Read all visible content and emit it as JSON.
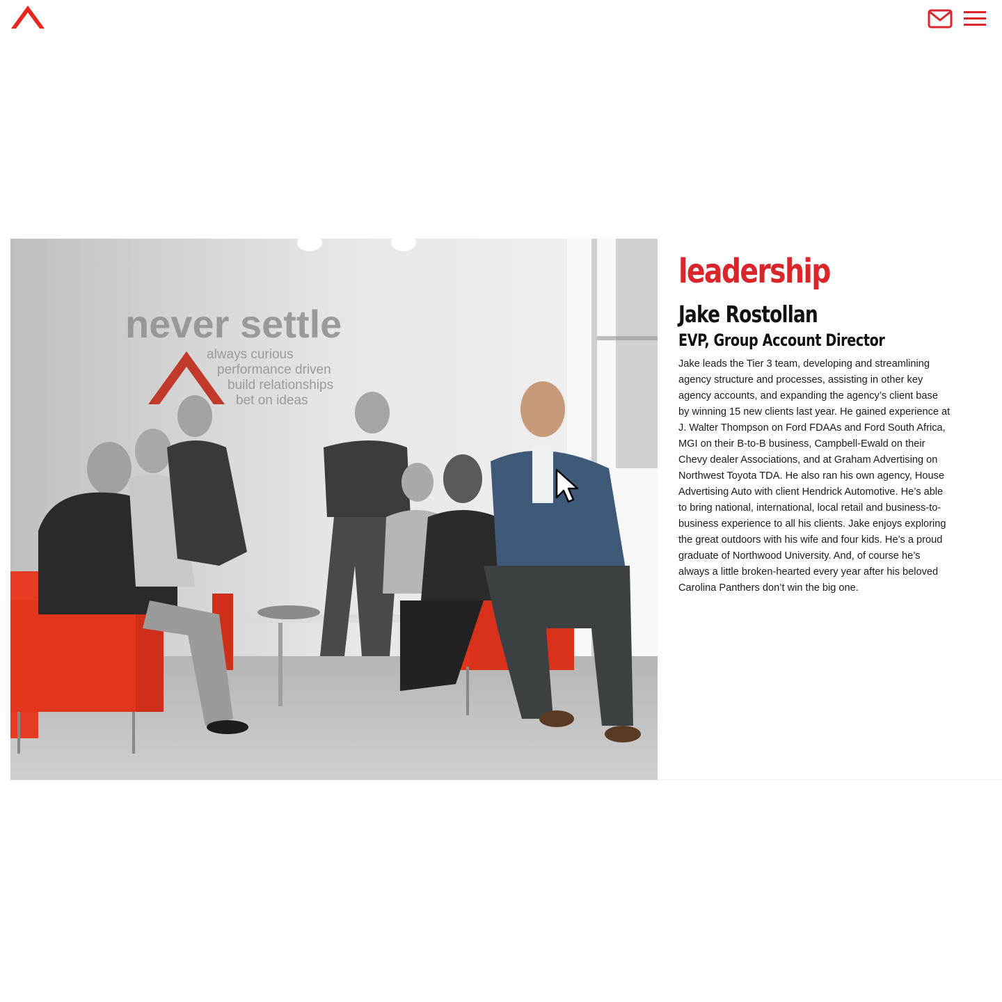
{
  "header": {
    "logo_alt": "agency logo",
    "contact_icon": "mail-icon",
    "menu_icon": "hamburger-menu-icon"
  },
  "photo": {
    "wall_headline": "never settle",
    "wall_values": [
      "always curious",
      "performance driven",
      "build relationships",
      "bet on ideas"
    ]
  },
  "leadership": {
    "section_title": "leadership",
    "name": "Jake Rostollan",
    "role": "EVP, Group Account Director",
    "bio": "Jake leads the Tier 3 team, developing and streamlining agency structure and processes, assisting in other key agency accounts, and expanding the agency’s client base by winning 15 new clients last year. He gained experience at J. Walter Thompson on Ford FDAAs and Ford South Africa, MGI on their B-to-B business, Campbell-Ewald on their Chevy dealer Associations, and at Graham Advertising on Northwest Toyota TDA. He also ran his own agency, House Advertising Auto with client Hendrick Automotive. He’s able to bring national, international, local retail and business-to-business experience to all his clients. Jake enjoys exploring the great outdoors with his wife and four kids. He’s a proud graduate of Northwood University. And, of course he’s always a little broken-hearted every year after his beloved Carolina Panthers don’t win the big one."
  },
  "colors": {
    "brand_red": "#d9262a",
    "text_dark": "#111111",
    "background": "#ffffff"
  }
}
